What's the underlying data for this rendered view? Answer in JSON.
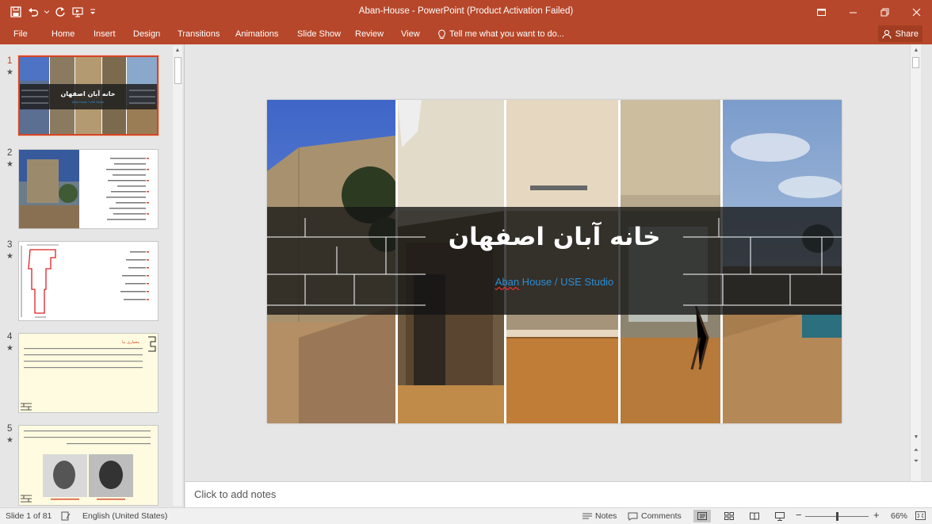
{
  "window": {
    "title": "Aban-House - PowerPoint (Product Activation Failed)",
    "qat_icons": [
      "save-icon",
      "undo-icon",
      "dropdown-icon",
      "redo-icon",
      "start-from-beginning-icon",
      "customize-qat-icon"
    ]
  },
  "ribbon": {
    "tabs": [
      "File",
      "Home",
      "Insert",
      "Design",
      "Transitions",
      "Animations",
      "Slide Show",
      "Review",
      "View"
    ],
    "tell_me": "Tell me what you want to do...",
    "share": "Share"
  },
  "thumbnails": [
    {
      "number": "1",
      "title": "خانه آبان اصفهان",
      "sub": "Aban House / USE Studio",
      "selected": true
    },
    {
      "number": "2",
      "selected": false
    },
    {
      "number": "3",
      "selected": false
    },
    {
      "number": "4",
      "heading": "معماری بنا",
      "selected": false
    },
    {
      "number": "5",
      "selected": false
    }
  ],
  "slide": {
    "title": "خانه آبان اصفهان",
    "subtitle_part1": "Aban",
    "subtitle_part2": " House / USE Studio"
  },
  "notes": {
    "placeholder": "Click to add notes"
  },
  "status": {
    "slide_counter": "Slide 1 of 81",
    "language": "English (United States)",
    "notes_label": "Notes",
    "comments_label": "Comments",
    "zoom_level": "66%",
    "zoom_fraction": 0.5
  },
  "colors": {
    "accent": "#b7472a",
    "selection": "#d24726",
    "subtitle": "#2b8fd6"
  }
}
